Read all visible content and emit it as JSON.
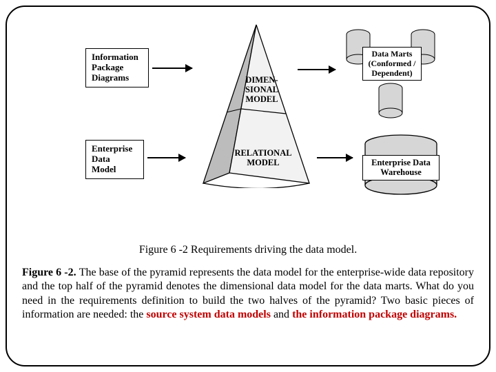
{
  "left": {
    "info_pkg": "Information\nPackage\nDiagrams",
    "ent_model": "Enterprise\nData\nModel"
  },
  "pyramid": {
    "top": "DIMEN-\nSIONAL\nMODEL",
    "bottom": "RELATIONAL\nMODEL"
  },
  "right": {
    "marts": "Data Marts\n(Conformed /\nDependent)",
    "edw": "Enterprise Data\nWarehouse"
  },
  "caption": "Figure 6 -2 Requirements driving the data model.",
  "para": {
    "lead": "Figure 6 -2. ",
    "p1": "The base of the pyramid represents the data model for the enterprise-wide data repository and the top half of the pyramid denotes the dimensional data model for the data marts. What do you need in the requirements definition to build  the two halves of the pyramid? Two basic pieces of information are needed: the ",
    "r1": "source system data models",
    "mid": " and ",
    "r2": "the information package diagrams."
  }
}
